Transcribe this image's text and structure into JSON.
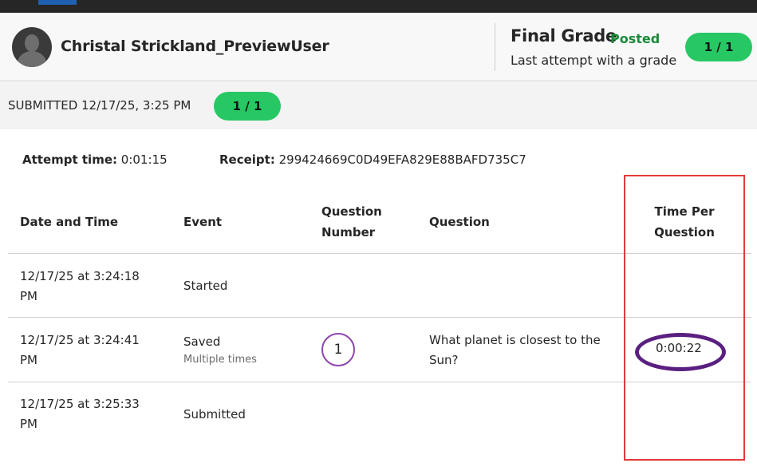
{
  "header": {
    "user_name": "Christal Strickland_PreviewUser",
    "final_grade_label": "Final Grade",
    "posted_label": "Posted",
    "last_attempt_label": "Last attempt with a grade",
    "final_grade_value": "1 / 1"
  },
  "submission": {
    "submitted_text": "SUBMITTED 12/17/25, 3:25 PM",
    "grade": "1 / 1"
  },
  "attempt": {
    "time_label": "Attempt time:",
    "time_value": "0:01:15",
    "receipt_label": "Receipt:",
    "receipt_value": "299424669C0D49EFA829E88BAFD735C7"
  },
  "table": {
    "headers": {
      "date": "Date and Time",
      "event": "Event",
      "question_number": "Question Number",
      "question": "Question",
      "time_per_question": "Time Per Question"
    },
    "rows": [
      {
        "date": "12/17/25 at 3:24:18 PM",
        "event": "Started",
        "event_sub": "",
        "question_number": "",
        "question": "",
        "time": ""
      },
      {
        "date": "12/17/25 at 3:24:41 PM",
        "event": "Saved",
        "event_sub": "Multiple times",
        "question_number": "1",
        "question": "What planet is closest to the Sun?",
        "time": "0:00:22"
      },
      {
        "date": "12/17/25 at 3:25:33 PM",
        "event": "Submitted",
        "event_sub": "",
        "question_number": "",
        "question": "",
        "time": ""
      }
    ]
  },
  "colors": {
    "grade_pill": "#27c864",
    "posted_text": "#1a8a3a",
    "highlight_box": "#e23a3a",
    "highlight_oval": "#5a1f80",
    "question_badge_border": "#8e44ad"
  },
  "icons": {
    "avatar": "user-avatar-icon"
  }
}
